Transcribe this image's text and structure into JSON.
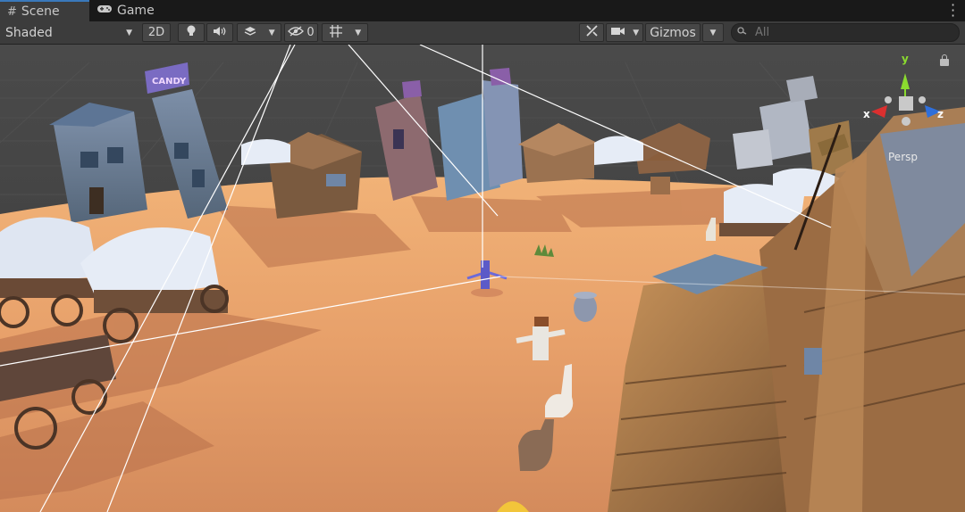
{
  "tabs": [
    {
      "label": "Scene",
      "icon": "hash-icon",
      "active": true
    },
    {
      "label": "Game",
      "icon": "gamepad-icon",
      "active": false
    }
  ],
  "toolbar": {
    "shading_mode": "Shaded",
    "toggle_2d": "2D",
    "hidden_count": "0",
    "gizmos_label": "Gizmos",
    "search_placeholder": "All"
  },
  "scene_gizmo": {
    "axis_y": "y",
    "axis_x": "x",
    "axis_z": "z",
    "projection": "Persp"
  },
  "signs": {
    "left": "CANDY"
  },
  "colors": {
    "tab_active_accent": "#3a79bb",
    "toolbar_bg": "#3c3c3c",
    "axis_y": "#8bdb2f",
    "axis_x": "#db2f2f",
    "axis_z": "#2f6fdb"
  }
}
